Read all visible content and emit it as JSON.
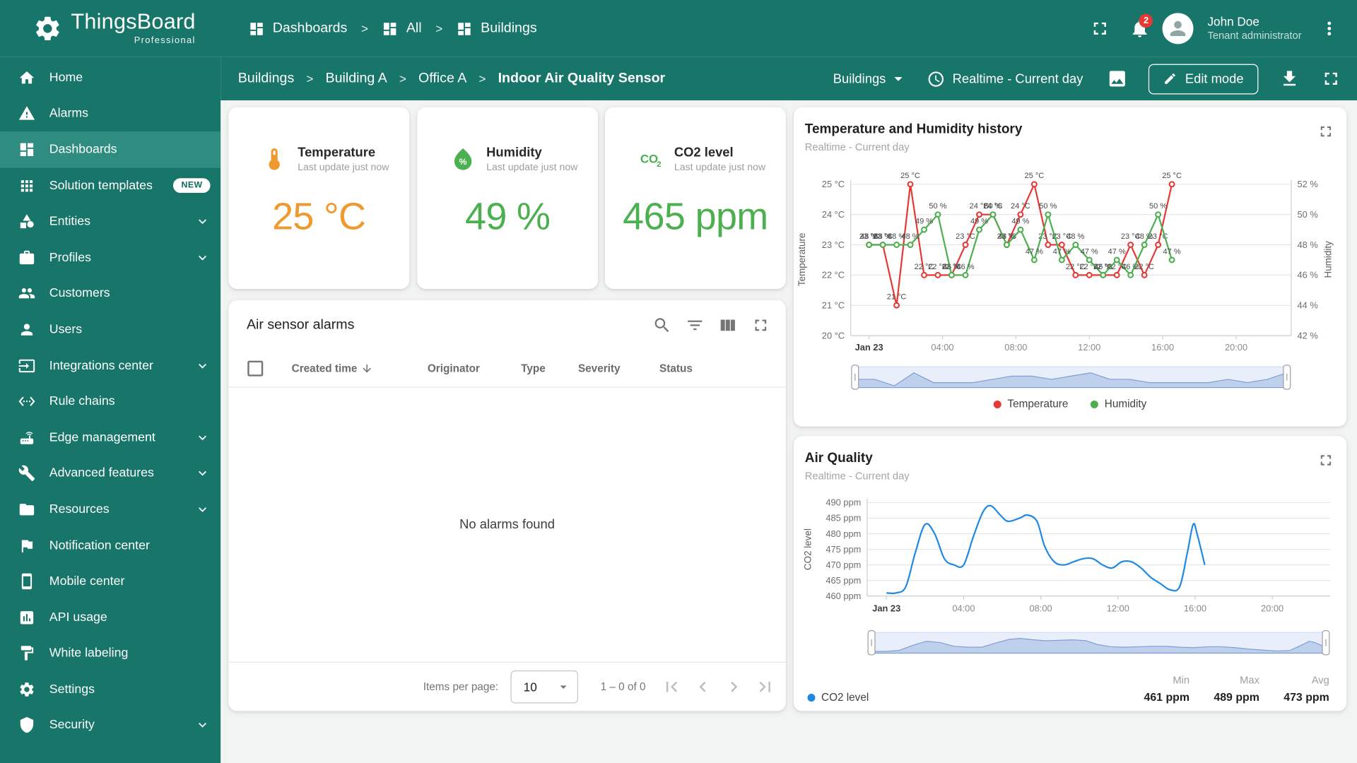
{
  "app": {
    "brand": {
      "name": "ThingsBoard",
      "tagline": "Professional"
    },
    "separator": ">",
    "top_breadcrumb": [
      {
        "label": "Dashboards",
        "icon": "dashboard"
      },
      {
        "label": "All",
        "icon": "dashboard"
      },
      {
        "label": "Buildings",
        "icon": "dashboard"
      }
    ],
    "notifications_count": "2",
    "user": {
      "name": "John Doe",
      "role": "Tenant administrator"
    }
  },
  "toolbar": {
    "breadcrumb": [
      "Buildings",
      "Building A",
      "Office A",
      "Indoor Air Quality Sensor"
    ],
    "states_select": "Buildings",
    "time_window": "Realtime - Current day",
    "edit_label": "Edit mode"
  },
  "sidebar": {
    "items": [
      {
        "label": "Home",
        "icon": "home"
      },
      {
        "label": "Alarms",
        "icon": "warning"
      },
      {
        "label": "Dashboards",
        "icon": "dashboard",
        "active": true
      },
      {
        "label": "Solution templates",
        "icon": "apps",
        "badge": "NEW"
      },
      {
        "label": "Entities",
        "icon": "category",
        "expandable": true
      },
      {
        "label": "Profiles",
        "icon": "work",
        "expandable": true
      },
      {
        "label": "Customers",
        "icon": "people"
      },
      {
        "label": "Users",
        "icon": "person"
      },
      {
        "label": "Integrations center",
        "icon": "input",
        "expandable": true
      },
      {
        "label": "Rule chains",
        "icon": "ethernet"
      },
      {
        "label": "Edge management",
        "icon": "router",
        "expandable": true
      },
      {
        "label": "Advanced features",
        "icon": "build",
        "expandable": true
      },
      {
        "label": "Resources",
        "icon": "folder",
        "expandable": true
      },
      {
        "label": "Notification center",
        "icon": "flag"
      },
      {
        "label": "Mobile center",
        "icon": "smartphone"
      },
      {
        "label": "API usage",
        "icon": "insert_chart"
      },
      {
        "label": "White labeling",
        "icon": "format_paint"
      },
      {
        "label": "Settings",
        "icon": "settings"
      },
      {
        "label": "Security",
        "icon": "shield",
        "expandable": true
      }
    ]
  },
  "kpis": [
    {
      "title": "Temperature",
      "subtitle": "Last update just now",
      "value": "25 °C",
      "icon": "thermometer",
      "color": "#f0992e"
    },
    {
      "title": "Humidity",
      "subtitle": "Last update just now",
      "value": "49 %",
      "icon": "humidity",
      "color": "#4caf50"
    },
    {
      "title": "CO2 level",
      "subtitle": "Last update just now",
      "value": "465 ppm",
      "icon": "co2",
      "color": "#4caf50"
    }
  ],
  "alarms": {
    "title": "Air sensor alarms",
    "columns": [
      "Created time",
      "Originator",
      "Type",
      "Severity",
      "Status"
    ],
    "empty_text": "No alarms found",
    "items_per_page_label": "Items per page:",
    "items_per_page_value": "10",
    "range_text": "1 – 0 of 0"
  },
  "chart_data": [
    {
      "type": "line",
      "title": "Temperature and Humidity history",
      "subtitle": "Realtime - Current day",
      "grid": true,
      "legend_position": "bottom",
      "x_axis": {
        "domain": [
          -1,
          23
        ],
        "ticks": [
          {
            "h": 0,
            "label": "Jan 23",
            "bold": true
          },
          {
            "h": 4,
            "label": "04:00"
          },
          {
            "h": 8,
            "label": "08:00"
          },
          {
            "h": 12,
            "label": "12:00"
          },
          {
            "h": 16,
            "label": "16:00"
          },
          {
            "h": 20,
            "label": "20:00"
          }
        ]
      },
      "left_axis": {
        "label": "Temperature",
        "min": 20,
        "max": 25,
        "tick_suffix": " °C",
        "ticks": [
          20,
          21,
          22,
          23,
          24,
          25
        ]
      },
      "right_axis": {
        "label": "Humidity",
        "min": 42,
        "max": 52,
        "tick_suffix": " %",
        "ticks": [
          42,
          44,
          46,
          48,
          50,
          52
        ]
      },
      "series": [
        {
          "name": "Temperature",
          "color": "#e53935",
          "axis": "left",
          "unit": "°C",
          "x": [
            0,
            0.75,
            1.5,
            2.25,
            3,
            3.75,
            4.5,
            5.25,
            6,
            6.75,
            7.5,
            8.25,
            9,
            9.75,
            10.5,
            11.25,
            12,
            12.75,
            13.5,
            14.25,
            15,
            15.75,
            16.5
          ],
          "values": [
            23,
            23,
            21,
            25,
            22,
            22,
            22,
            23,
            24,
            24,
            23,
            24,
            25,
            23,
            23,
            22,
            22,
            22,
            22,
            23,
            22,
            23,
            25
          ]
        },
        {
          "name": "Humidity",
          "color": "#4caf50",
          "axis": "right",
          "unit": "%",
          "x": [
            0,
            0.75,
            1.5,
            2.25,
            3,
            3.75,
            4.5,
            5.25,
            6,
            6.75,
            7.5,
            8.25,
            9,
            9.75,
            10.5,
            11.25,
            12,
            12.75,
            13.5,
            14.25,
            15,
            15.75,
            16.5
          ],
          "values": [
            48,
            48,
            48,
            48,
            49,
            50,
            46,
            46,
            49,
            50,
            48,
            49,
            47,
            50,
            47,
            48,
            47,
            46,
            47,
            46,
            48,
            50,
            47
          ]
        }
      ]
    },
    {
      "type": "line",
      "title": "Air Quality",
      "subtitle": "Realtime - Current day",
      "grid": true,
      "x_axis": {
        "domain": [
          -1,
          23
        ],
        "ticks": [
          {
            "h": 0,
            "label": "Jan 23",
            "bold": true
          },
          {
            "h": 4,
            "label": "04:00"
          },
          {
            "h": 8,
            "label": "08:00"
          },
          {
            "h": 12,
            "label": "12:00"
          },
          {
            "h": 16,
            "label": "16:00"
          },
          {
            "h": 20,
            "label": "20:00"
          }
        ]
      },
      "y_axis": {
        "label": "CO2 level",
        "min": 460,
        "max": 490,
        "tick_suffix": " ppm",
        "ticks": [
          460,
          465,
          470,
          475,
          480,
          485,
          490
        ]
      },
      "series": [
        {
          "name": "CO2 level",
          "color": "#1e88e5",
          "axis": "left",
          "unit": "ppm",
          "x": [
            0,
            0.5,
            1,
            1.5,
            2,
            2.5,
            3,
            3.5,
            4,
            4.5,
            5,
            5.4,
            5.9,
            6.3,
            6.9,
            7.3,
            7.8,
            8.2,
            8.7,
            9.2,
            9.7,
            10.2,
            10.7,
            11.2,
            11.7,
            12.2,
            12.7,
            13.2,
            13.7,
            14.2,
            14.7,
            15.2,
            15.6,
            15.9,
            16.1,
            16.5
          ],
          "values": [
            461,
            461,
            463,
            474,
            483,
            480,
            472,
            470,
            470,
            479,
            487,
            489,
            486,
            484,
            485,
            486,
            484,
            476,
            471,
            470,
            471,
            472,
            472,
            470,
            469,
            471,
            471,
            469,
            466,
            464,
            462,
            463,
            474,
            483,
            480,
            470
          ]
        }
      ],
      "stats": {
        "min_label": "Min",
        "max_label": "Max",
        "avg_label": "Avg",
        "min_value": "461 ppm",
        "max_value": "489 ppm",
        "avg_value": "473 ppm"
      }
    }
  ]
}
